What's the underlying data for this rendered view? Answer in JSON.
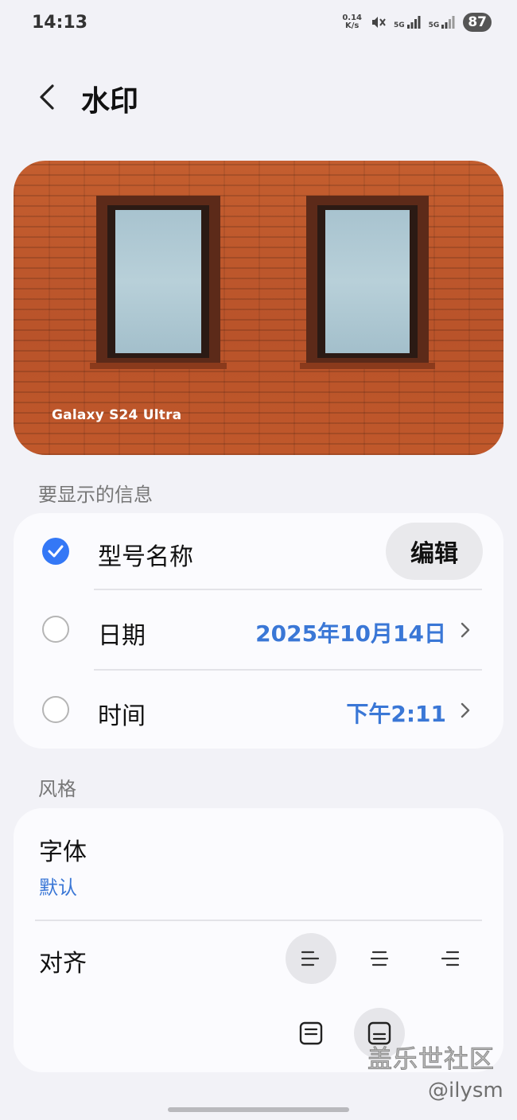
{
  "status_bar": {
    "time": "14:13",
    "net_speed_value": "0.14",
    "net_speed_unit": "K/s",
    "sim1_type": "5G",
    "sim2_type": "5G",
    "battery": "87"
  },
  "header": {
    "title": "水印"
  },
  "preview": {
    "watermark_text": "Galaxy S24 Ultra"
  },
  "info_section": {
    "label": "要显示的信息",
    "items": [
      {
        "label": "型号名称",
        "checked": true,
        "action": "编辑"
      },
      {
        "label": "日期",
        "checked": false,
        "value": "2025年10月14日"
      },
      {
        "label": "时间",
        "checked": false,
        "value": "下午2:11"
      }
    ]
  },
  "style_section": {
    "label": "风格",
    "font_title": "字体",
    "font_value": "默认",
    "align_label": "对齐",
    "align_options": [
      "align-left",
      "align-center",
      "align-right"
    ],
    "selected_align": "align-left",
    "position_options": [
      "frame-top",
      "frame-bottom"
    ],
    "selected_position": "frame-bottom"
  },
  "overlay": {
    "brand": "盖乐世社区",
    "handle": "@ilysm"
  },
  "colors": {
    "accent": "#3478f6",
    "value_text": "#3a77d6",
    "background": "#f2f2f7",
    "card": "#fbfbfe"
  }
}
